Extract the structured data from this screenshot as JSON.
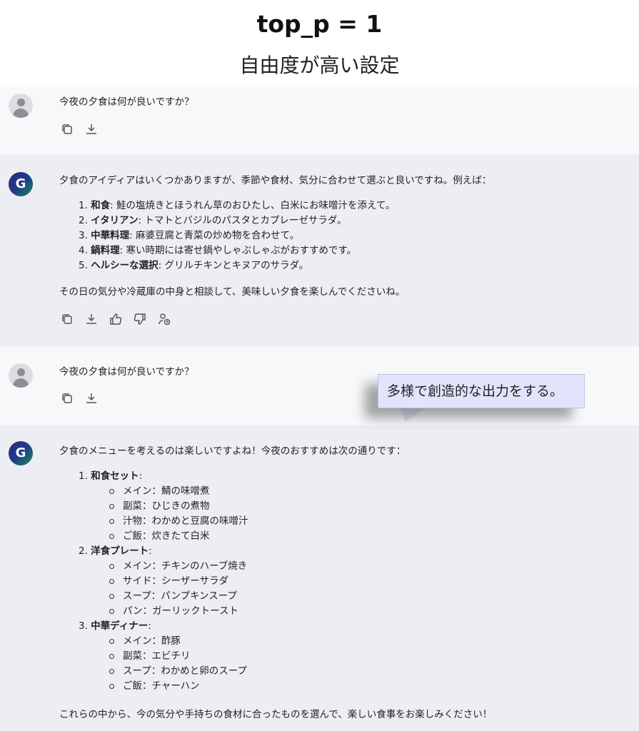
{
  "header": {
    "title": "top_p = 1",
    "subtitle": "自由度が高い設定"
  },
  "conversation": [
    {
      "role": "user",
      "text": "今夜の夕食は何が良いですか？"
    },
    {
      "role": "assistant",
      "intro": "夕食のアイディアはいくつかありますが、季節や食材、気分に合わせて選ぶと良いですね。例えば：",
      "items": [
        {
          "num": "1. ",
          "bold": "和食",
          "rest": ": 鮭の塩焼きとほうれん草のおひたし、白米にお味噌汁を添えて。"
        },
        {
          "num": "2. ",
          "bold": "イタリアン",
          "rest": ": トマトとバジルのパスタとカプレーゼサラダ。"
        },
        {
          "num": "3. ",
          "bold": "中華料理",
          "rest": ": 麻婆豆腐と青菜の炒め物を合わせて。"
        },
        {
          "num": "4. ",
          "bold": "鍋料理",
          "rest": ": 寒い時期には寄せ鍋やしゃぶしゃぶがおすすめです。"
        },
        {
          "num": "5. ",
          "bold": "ヘルシーな選択",
          "rest": ": グリルチキンとキヌアのサラダ。"
        }
      ],
      "outro": "その日の気分や冷蔵庫の中身と相談して、美味しい夕食を楽しんでくださいね。"
    },
    {
      "role": "user",
      "text": "今夜の夕食は何が良いですか？"
    },
    {
      "role": "assistant",
      "intro": "夕食のメニューを考えるのは楽しいですよね！今夜のおすすめは次の通りです：",
      "sections": [
        {
          "num": "1. ",
          "bold": "和食セット",
          "rest": ":",
          "subs": [
            "メイン：鯖の味噌煮",
            "副菜：ひじきの煮物",
            "汁物：わかめと豆腐の味噌汁",
            "ご飯：炊きたて白米"
          ]
        },
        {
          "num": "2. ",
          "bold": "洋食プレート",
          "rest": ":",
          "subs": [
            "メイン：チキンのハーブ焼き",
            "サイド：シーザーサラダ",
            "スープ：パンプキンスープ",
            "パン：ガーリックトースト"
          ]
        },
        {
          "num": "3. ",
          "bold": "中華ディナー",
          "rest": ":",
          "subs": [
            "メイン：酢豚",
            "副菜：エビチリ",
            "スープ：わかめと卵のスープ",
            "ご飯：チャーハン"
          ]
        }
      ],
      "outro": "これらの中から、今の気分や手持ちの食材に合ったものを選んで、楽しい食事をお楽しみください！"
    }
  ],
  "callout": {
    "text": "多様で創造的な出力をする。"
  },
  "icons": {
    "user_actions": [
      "copy-icon",
      "download-icon"
    ],
    "assistant_actions": [
      "copy-icon",
      "download-icon",
      "thumbs-up-icon",
      "thumbs-down-icon",
      "share-icon"
    ]
  },
  "colors": {
    "user_bg": "#f7f8fa",
    "assistant_bg": "#eceef3",
    "callout_bg": "#e1e4fb"
  }
}
